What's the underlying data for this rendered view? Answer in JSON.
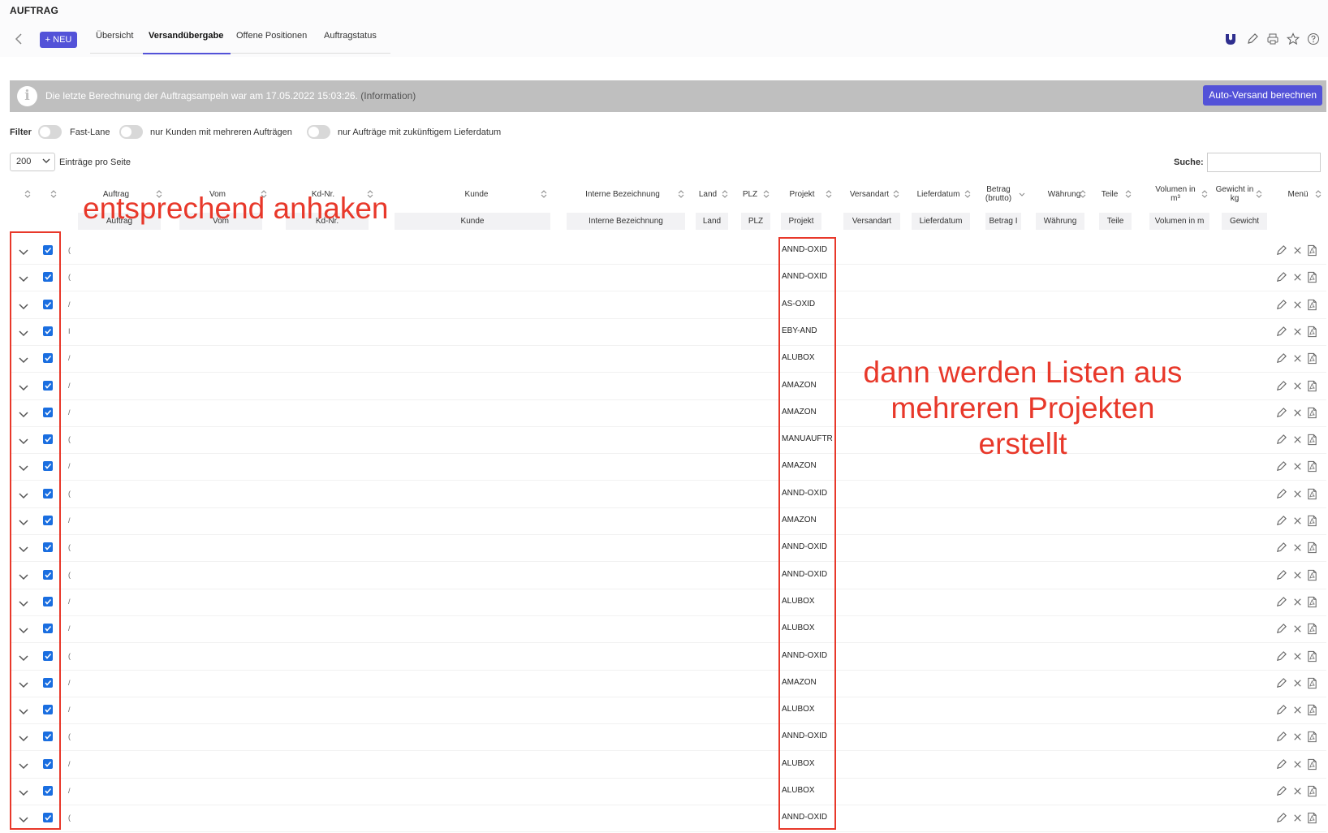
{
  "page": {
    "title": "AUFTRAG"
  },
  "header": {
    "new_button": "+ NEU",
    "tabs": [
      {
        "label": "Übersicht",
        "active": false
      },
      {
        "label": "Versandübergabe",
        "active": true
      },
      {
        "label": "Offene Positionen",
        "active": false
      },
      {
        "label": "Auftragstatus",
        "active": false
      }
    ],
    "toolbar_icons": [
      "logo-icon",
      "pencil-icon",
      "printer-icon",
      "star-icon",
      "help-icon"
    ]
  },
  "info": {
    "text": "Die letzte Berechnung der Auftragsampeln war am 17.05.2022 15:03:26.",
    "paren": "(Information)",
    "button": "Auto-Versand berechnen"
  },
  "filter": {
    "label": "Filter",
    "toggles": [
      {
        "label": "Fast-Lane",
        "on": false
      },
      {
        "label": "nur Kunden mit mehreren Aufträgen",
        "on": false
      },
      {
        "label": "nur Aufträge mit zukünftigem Lieferdatum",
        "on": false
      }
    ]
  },
  "paging": {
    "value": "200",
    "label": "Einträge pro Seite"
  },
  "search": {
    "label": "Suche:",
    "value": ""
  },
  "table": {
    "columns": [
      "Auftrag",
      "Vom",
      "Kd-Nr.",
      "Kunde",
      "Interne Bezeichnung",
      "Land",
      "PLZ",
      "Projekt",
      "Versandart",
      "Lieferdatum",
      "Betrag (brutto)",
      "Währung",
      "Teile",
      "Volumen in m³",
      "Gewicht in kg",
      "Menü"
    ],
    "filter_placeholders": [
      "Auftrag",
      "Vom",
      "Kd-Nr.",
      "Kunde",
      "Interne Bezeichnung",
      "Land",
      "PLZ",
      "Projekt",
      "Versandart",
      "Lieferdatum",
      "Betrag I",
      "Währung",
      "Teile",
      "Volumen in m",
      "Gewicht"
    ],
    "rows": [
      {
        "trunc": "(",
        "projekt": "ANND-OXID",
        "checked": true
      },
      {
        "trunc": "(",
        "projekt": "ANND-OXID",
        "checked": true
      },
      {
        "trunc": "/",
        "projekt": "AS-OXID",
        "checked": true
      },
      {
        "trunc": "I",
        "projekt": "EBY-AND",
        "checked": true
      },
      {
        "trunc": "/",
        "projekt": "ALUBOX",
        "checked": true
      },
      {
        "trunc": "/",
        "projekt": "AMAZON",
        "checked": true
      },
      {
        "trunc": "/",
        "projekt": "AMAZON",
        "checked": true
      },
      {
        "trunc": "(",
        "projekt": "MANUAUFTR",
        "checked": true
      },
      {
        "trunc": "/",
        "projekt": "AMAZON",
        "checked": true
      },
      {
        "trunc": "(",
        "projekt": "ANND-OXID",
        "checked": true
      },
      {
        "trunc": "/",
        "projekt": "AMAZON",
        "checked": true
      },
      {
        "trunc": "(",
        "projekt": "ANND-OXID",
        "checked": true
      },
      {
        "trunc": "(",
        "projekt": "ANND-OXID",
        "checked": true
      },
      {
        "trunc": "/",
        "projekt": "ALUBOX",
        "checked": true
      },
      {
        "trunc": "/",
        "projekt": "ALUBOX",
        "checked": true
      },
      {
        "trunc": "(",
        "projekt": "ANND-OXID",
        "checked": true
      },
      {
        "trunc": "/",
        "projekt": "AMAZON",
        "checked": true
      },
      {
        "trunc": "/",
        "projekt": "ALUBOX",
        "checked": true
      },
      {
        "trunc": "(",
        "projekt": "ANND-OXID",
        "checked": true
      },
      {
        "trunc": "/",
        "projekt": "ALUBOX",
        "checked": true
      },
      {
        "trunc": "/",
        "projekt": "ALUBOX",
        "checked": true
      },
      {
        "trunc": "(",
        "projekt": "ANND-OXID",
        "checked": true
      }
    ]
  },
  "annotations": {
    "left": "entsprechend anhaken",
    "right_lines": [
      "dann werden Listen aus",
      "mehreren Projekten",
      "erstellt"
    ],
    "color": "#e8382a"
  },
  "colors": {
    "accent": "#5352d8",
    "checkbox": "#1a6ee0",
    "infobar": "#bfbfbf"
  }
}
